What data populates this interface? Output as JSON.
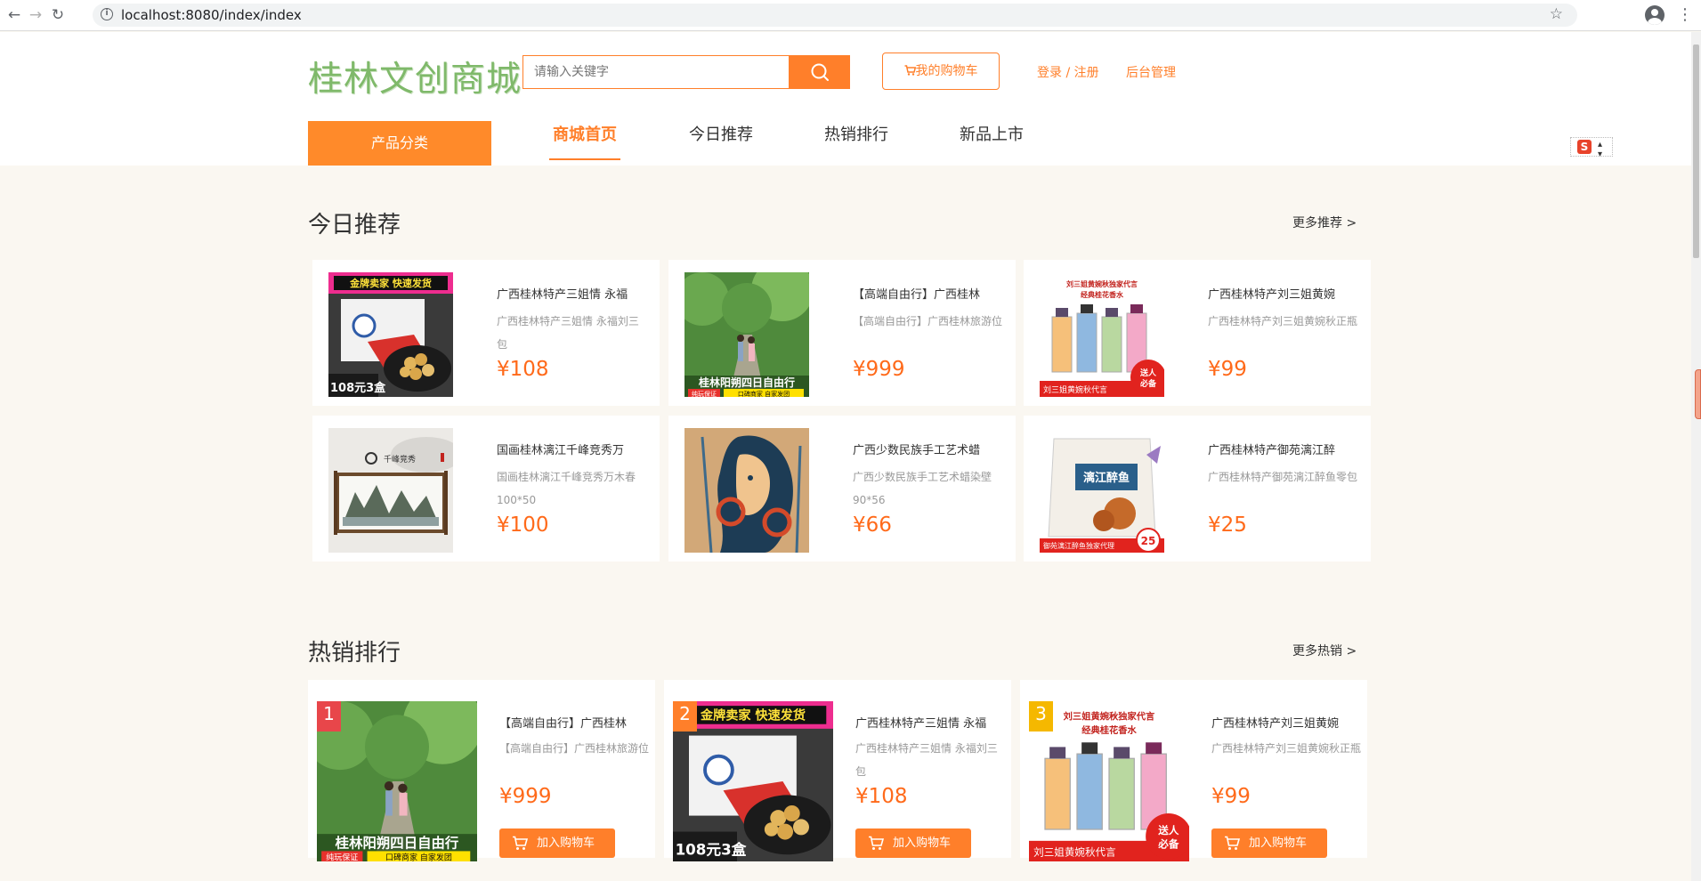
{
  "browser": {
    "url": "localhost:8080/index/index",
    "back": "←",
    "forward": "→",
    "reload": "↻",
    "star": "☆",
    "menu": "⋮"
  },
  "header": {
    "logo": "桂林文创商城",
    "search_placeholder": "请输入关键字",
    "cart_label": "我的购物车",
    "login_label": "登录 / 注册",
    "admin_label": "后台管理",
    "category_label": "产品分类",
    "nav": [
      "商城首页",
      "今日推荐",
      "热销排行",
      "新品上市"
    ],
    "ime_label": "S"
  },
  "colors": {
    "accent": "#ff7f2a",
    "price": "#ff6a1a",
    "logo": "#7fb96a",
    "page_bg": "#faf7f1"
  },
  "recommend": {
    "title": "今日推荐",
    "more": "更多推荐 >",
    "items": [
      {
        "name": "广西桂林特产三姐情 永福",
        "desc": "广西桂林特产三姐情 永福刘三包",
        "price": "¥108",
        "img": "snack-box",
        "img_text": [
          "金牌卖家 快速发货",
          "108元3盒"
        ]
      },
      {
        "name": "【高端自由行】广西桂林",
        "desc": "【高端自由行】广西桂林旅游位",
        "price": "¥999",
        "img": "travel-family",
        "img_text": [
          "桂林阳朔四日自由行",
          "纯玩保证",
          "口碑商家 自家发团"
        ]
      },
      {
        "name": "广西桂林特产刘三姐黄婉",
        "desc": "广西桂林特产刘三姐黄婉秋正瓶",
        "price": "¥99",
        "img": "perfume",
        "img_text": [
          "刘三姐黄婉秋独家代言",
          "经典桂花香水",
          "刘三姐黄婉秋代言",
          "送人必备"
        ]
      },
      {
        "name": "国画桂林漓江千峰竞秀万",
        "desc": "国画桂林漓江千峰竞秀万木春100*50",
        "price": "¥100",
        "img": "painting",
        "img_text": [
          "千峰竞秀"
        ]
      },
      {
        "name": "广西少数民族手工艺术蜡",
        "desc": "广西少数民族手工艺术蜡染壁90*56",
        "price": "¥66",
        "img": "batik",
        "img_text": []
      },
      {
        "name": "广西桂林特产御苑漓江醉",
        "desc": "广西桂林特产御苑漓江醉鱼零包",
        "price": "¥25",
        "img": "fish-snack",
        "img_text": [
          "漓江醉鱼",
          "御苑漓江醉鱼独家代理",
          "25"
        ]
      }
    ]
  },
  "hot": {
    "title": "热销排行",
    "more": "更多热销 >",
    "add_cart": "加入购物车",
    "items": [
      {
        "rank": "1",
        "rank_color": "#e8464a",
        "name": "【高端自由行】广西桂林",
        "desc": "【高端自由行】广西桂林旅游位",
        "price": "¥999",
        "img": "travel-family",
        "img_text": [
          "桂林阳朔四日自由行",
          "纯玩保证",
          "口碑商家 自家发团"
        ]
      },
      {
        "rank": "2",
        "rank_color": "#ff7f2a",
        "name": "广西桂林特产三姐情 永福",
        "desc": "广西桂林特产三姐情 永福刘三包",
        "price": "¥108",
        "img": "snack-box",
        "img_text": [
          "金牌卖家 快速发货",
          "108元3盒"
        ]
      },
      {
        "rank": "3",
        "rank_color": "#f5b800",
        "name": "广西桂林特产刘三姐黄婉",
        "desc": "广西桂林特产刘三姐黄婉秋正瓶",
        "price": "¥99",
        "img": "perfume",
        "img_text": [
          "刘三姐黄婉秋独家代言",
          "经典桂花香水",
          "刘三姐黄婉秋代言",
          "送人必备"
        ]
      }
    ]
  }
}
